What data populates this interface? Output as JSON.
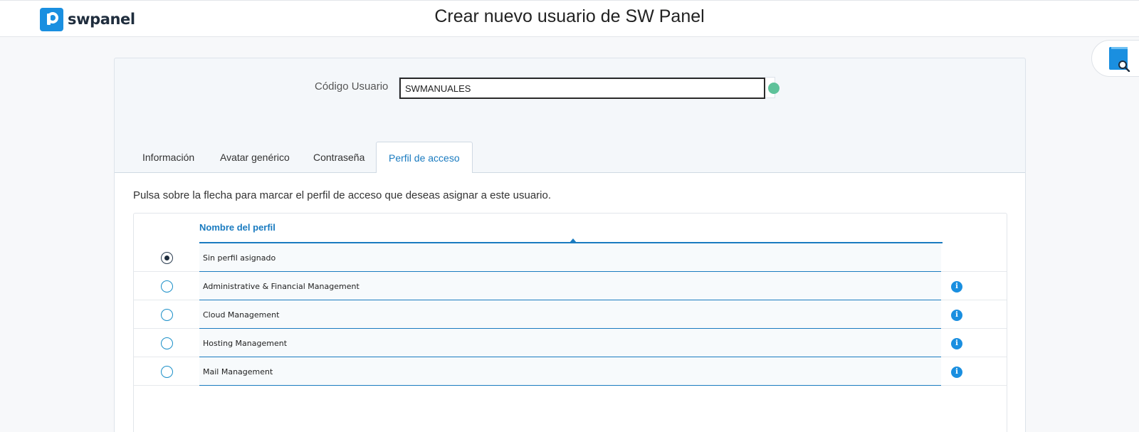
{
  "header": {
    "logo_text": "swpanel",
    "title": "Crear nuevo usuario de SW Panel"
  },
  "form": {
    "code_label": "Código Usuario",
    "code_value": "SWMANUALES",
    "status_color": "#5ec29a"
  },
  "tabs": [
    {
      "label": "Información",
      "active": false
    },
    {
      "label": "Avatar genérico",
      "active": false
    },
    {
      "label": "Contraseña",
      "active": false
    },
    {
      "label": "Perfil de acceso",
      "active": true
    }
  ],
  "panel": {
    "instruction": "Pulsa sobre la flecha para marcar el perfil de acceso que deseas asignar a este usuario.",
    "column_header": "Nombre del perfil",
    "rows": [
      {
        "name": "Sin perfil asignado",
        "selected": true,
        "info_icon": false
      },
      {
        "name": "Administrative & Financial Management",
        "selected": false,
        "info_icon": true
      },
      {
        "name": "Cloud Management",
        "selected": false,
        "info_icon": true
      },
      {
        "name": "Hosting Management",
        "selected": false,
        "info_icon": true
      },
      {
        "name": "Mail Management",
        "selected": false,
        "info_icon": true
      }
    ]
  },
  "icons": {
    "logo": "swpanel-logo-icon",
    "help": "manual-search-icon",
    "info": "info-icon",
    "sort": "sort-caret-icon"
  },
  "colors": {
    "accent": "#1a7bc0",
    "brand": "#1a8fe0",
    "status_ok": "#5ec29a"
  }
}
